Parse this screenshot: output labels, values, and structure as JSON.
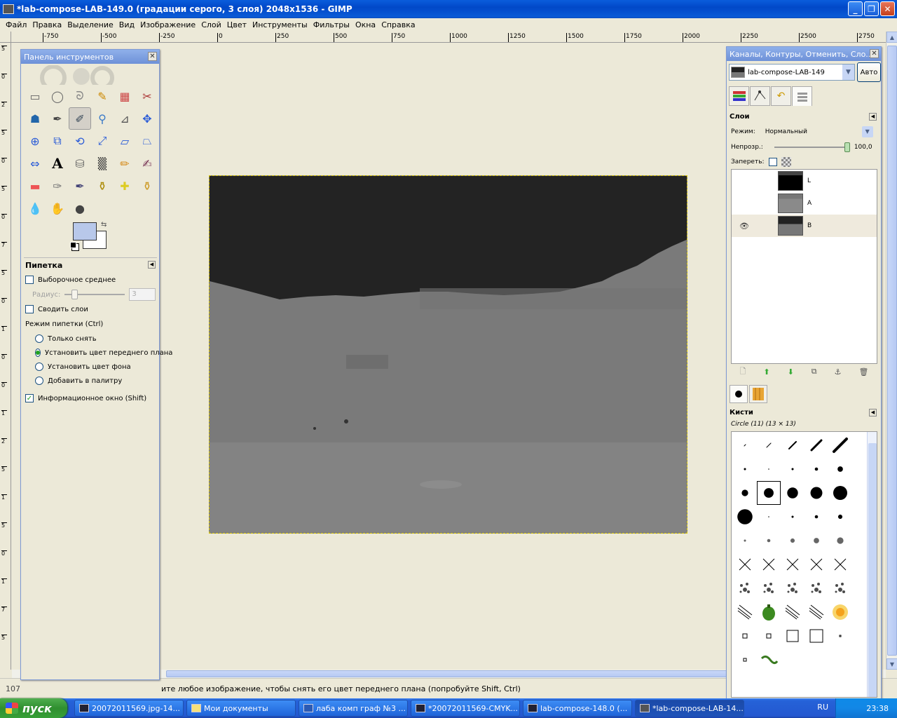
{
  "window": {
    "title": "*lab-compose-LAB-149.0 (градации серого, 3 слоя) 2048x1536 - GIMP",
    "buttons": [
      "_",
      "❐",
      "✕"
    ]
  },
  "menu": [
    "Файл",
    "Правка",
    "Выделение",
    "Вид",
    "Изображение",
    "Слой",
    "Цвет",
    "Инструменты",
    "Фильтры",
    "Окна",
    "Справка"
  ],
  "ruler": {
    "h_ticks": [
      "-750",
      "-500",
      "-250",
      "0",
      "250",
      "500",
      "750",
      "1000",
      "1250",
      "1500",
      "1750",
      "2000",
      "2250",
      "2500",
      "2750"
    ],
    "v_ticks": [
      "5",
      "0",
      "2",
      "5",
      "0",
      "5",
      "0",
      "7",
      "5",
      "0",
      "1",
      "0",
      "0",
      "1",
      "2",
      "5",
      "1",
      "5",
      "0",
      "1",
      "7",
      "5"
    ]
  },
  "toolbox": {
    "title": "Панель инструментов",
    "close": "✕",
    "tools": [
      "rect-select",
      "ellipse-select",
      "lasso",
      "fuzzy-select",
      "color-select",
      "scissors",
      "foreground-select",
      "paths",
      "color-picker",
      "zoom",
      "measure",
      "move",
      "align",
      "crop",
      "rotate",
      "scale",
      "shear",
      "perspective",
      "flip",
      "text",
      "bucket-fill",
      "blend",
      "pencil",
      "paintbrush",
      "eraser",
      "airbrush",
      "ink",
      "clone",
      "heal",
      "perspective-clone",
      "blur",
      "smudge",
      "dodge-burn"
    ],
    "fg_color": "#b8c8ea",
    "bg_color": "#ffffff"
  },
  "tool_options": {
    "title": "Пипетка",
    "sample_average": "Выборочное среднее",
    "radius_label": "Радиус:",
    "radius_value": "3",
    "sample_merged": "Сводить слои",
    "mode_label": "Режим пипетки (Ctrl)",
    "modes": [
      "Только снять",
      "Установить цвет переднего плана",
      "Установить цвет фона",
      "Добавить в палитру"
    ],
    "selected_mode": 1,
    "info_window": "Информационное окно (Shift)",
    "info_window_checked": "✓"
  },
  "dock": {
    "title": "Каналы, Контуры, Отменить, Сло...",
    "image_name": "lab-compose-LAB-149",
    "auto_button": "Авто",
    "layers_title": "Слои",
    "mode_label": "Режим:",
    "mode_value": "Нормальный",
    "opacity_label": "Непрозр.:",
    "opacity_value": "100,0",
    "lock_label": "Запереть:",
    "layers": [
      {
        "name": "L",
        "visible": false
      },
      {
        "name": "A",
        "visible": false
      },
      {
        "name": "B",
        "visible": true
      }
    ],
    "brushes_title": "Кисти",
    "brush_name": "Circle (11) (13 × 13)"
  },
  "status": {
    "zoom": "107",
    "message": "ите любое изображение, чтобы снять его цвет переднего плана (попробуйте Shift, Ctrl)"
  },
  "taskbar": {
    "start": "пуск",
    "buttons": [
      "20072011569.jpg-14...",
      "Мои документы",
      "лаба комп граф №3 ...",
      "*20072011569-CMYK...",
      "lab-compose-148.0 (...",
      "*lab-compose-LAB-14..."
    ],
    "lang": "RU",
    "clock": "23:38"
  },
  "colors": {
    "titlebar": "#0148c8",
    "canvas_bg": "#ece9d8",
    "image_dark": "#232323",
    "image_light": "#7a7a7a"
  }
}
